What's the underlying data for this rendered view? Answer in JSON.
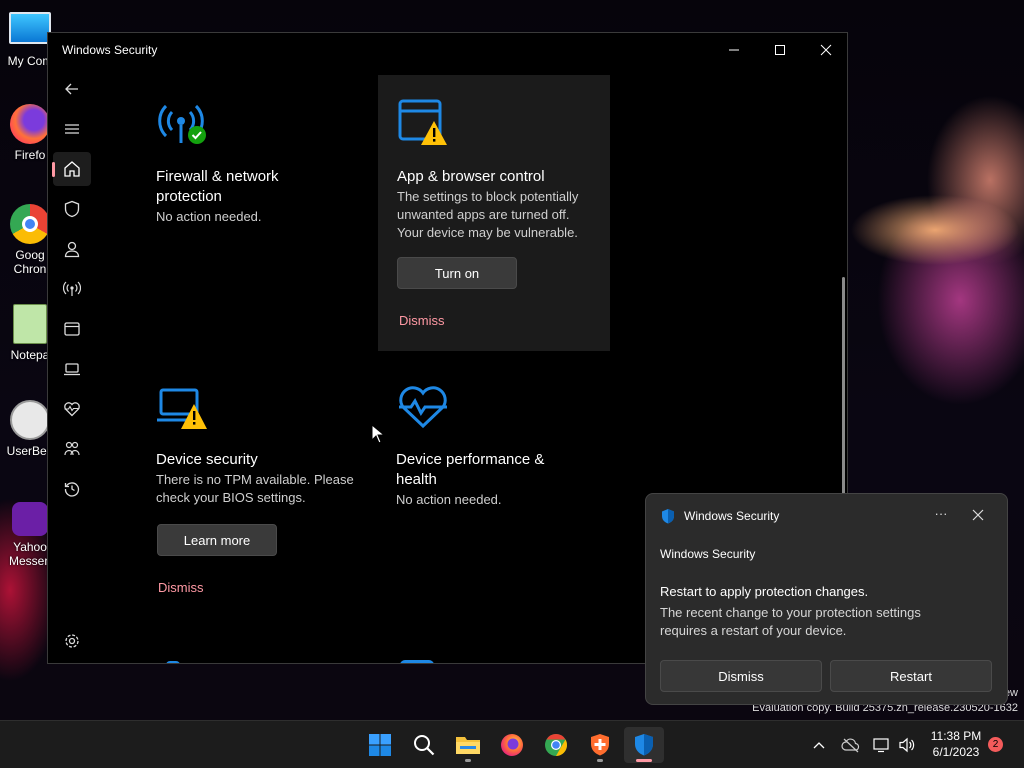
{
  "desktop": {
    "icons": [
      {
        "label": "My Com",
        "icon": "computer-icon"
      },
      {
        "label": "Firefo",
        "icon": "firefox-icon"
      },
      {
        "label": "Goog",
        "label2": "Chron",
        "icon": "chrome-icon"
      },
      {
        "label": "Notepa",
        "icon": "notepad-icon"
      },
      {
        "label": "UserBen",
        "icon": "userbenchmark-icon"
      },
      {
        "label": "Yahoo",
        "label2": "Messen",
        "icon": "yahoo-messenger-icon"
      }
    ],
    "watermark_line1": "ew",
    "watermark_line2": "Evaluation copy. Build 25375.zn_release.230520-1632"
  },
  "window": {
    "title": "Windows Security",
    "controls": {
      "minimize": "minimize-icon",
      "maximize": "maximize-icon",
      "close": "close-icon"
    },
    "nav": [
      {
        "name": "back",
        "icon": "back-arrow-icon"
      },
      {
        "name": "menu",
        "icon": "hamburger-icon"
      },
      {
        "name": "home",
        "icon": "home-icon",
        "active": true
      },
      {
        "name": "virus-protection",
        "icon": "shield-icon"
      },
      {
        "name": "account-protection",
        "icon": "person-icon"
      },
      {
        "name": "firewall",
        "icon": "antenna-icon"
      },
      {
        "name": "app-browser",
        "icon": "app-window-icon"
      },
      {
        "name": "device-security",
        "icon": "laptop-icon"
      },
      {
        "name": "device-performance",
        "icon": "heart-pulse-icon"
      },
      {
        "name": "family-options",
        "icon": "family-icon"
      },
      {
        "name": "protection-history",
        "icon": "history-icon"
      },
      {
        "name": "settings",
        "icon": "gear-icon"
      }
    ],
    "cards": {
      "firewall": {
        "title_line1": "Firewall & network",
        "title_line2": "protection",
        "desc": "No action needed."
      },
      "app_browser": {
        "title": "App & browser control",
        "desc_line1": "The settings to block potentially",
        "desc_line2": "unwanted apps are turned off.",
        "desc_line3": "Your device may be vulnerable.",
        "button": "Turn on",
        "dismiss": "Dismiss"
      },
      "device_security": {
        "title": "Device security",
        "desc_line1": "There is no TPM available. Please",
        "desc_line2": "check your BIOS settings.",
        "button": "Learn more",
        "dismiss": "Dismiss"
      },
      "device_performance": {
        "title_line1": "Device performance &",
        "title_line2": "health",
        "desc": "No action needed."
      }
    }
  },
  "toast": {
    "app_name": "Windows Security",
    "more_label": "···",
    "subtitle": "Windows Security",
    "heading": "Restart to apply protection changes.",
    "body_line1": "The recent change to your protection settings",
    "body_line2": "requires a restart of your device.",
    "dismiss_button": "Dismiss",
    "restart_button": "Restart"
  },
  "taskbar": {
    "apps": [
      {
        "name": "start",
        "icon": "windows-start-icon"
      },
      {
        "name": "search",
        "icon": "search-icon"
      },
      {
        "name": "file-explorer",
        "icon": "folder-icon"
      },
      {
        "name": "firefox",
        "icon": "firefox-icon"
      },
      {
        "name": "chrome",
        "icon": "chrome-icon"
      },
      {
        "name": "app",
        "icon": "shield-plus-icon"
      },
      {
        "name": "windows-security",
        "icon": "windows-security-shield-icon",
        "active": true
      }
    ],
    "time": "11:38 PM",
    "date": "6/1/2023",
    "notification_count": "2"
  },
  "colors": {
    "accent": "#ff99a4",
    "window_bg": "#000000",
    "card_bg": "#1b1b1b",
    "toast_bg": "#2b2b2b",
    "taskbar_bg": "#1c1c1c",
    "blue_icon": "#1e88e5",
    "warning": "#ffc107",
    "ok": "#13a10e"
  }
}
